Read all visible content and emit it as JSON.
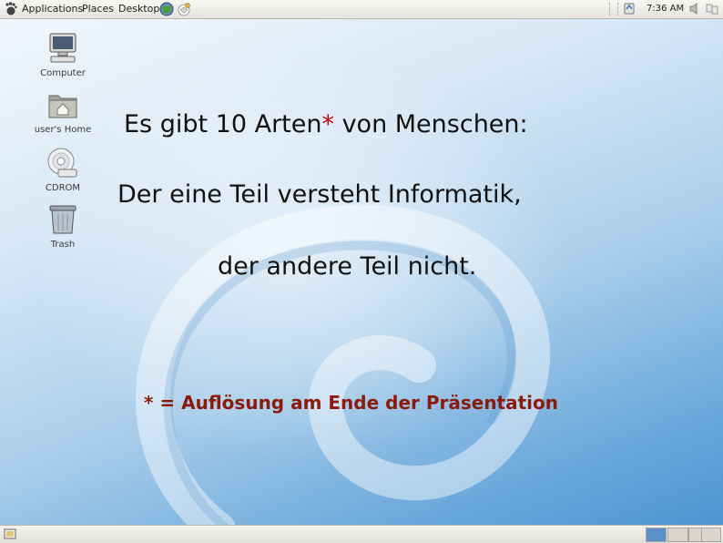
{
  "top_panel": {
    "menus": [
      "Applications",
      "Places",
      "Desktop"
    ],
    "clock": "7:36 AM"
  },
  "desktop": {
    "icons": [
      {
        "label": "Computer",
        "icon": "computer-icon"
      },
      {
        "label": "user's Home",
        "icon": "home-folder-icon"
      },
      {
        "label": "CDROM",
        "icon": "cdrom-icon"
      },
      {
        "label": "Trash",
        "icon": "trash-icon"
      }
    ],
    "slide": {
      "line1_before": "Es gibt 10 Arten",
      "line1_star": "*",
      "line1_after": " von Menschen:",
      "line2": "Der eine Teil versteht Informatik,",
      "line3": "der andere Teil nicht.",
      "footnote": "* = Auflösung am Ende der Präsentation"
    }
  },
  "colors": {
    "star": "#c00000",
    "footnote": "#8a1a0a",
    "active_workspace": "#5b8fc7"
  }
}
